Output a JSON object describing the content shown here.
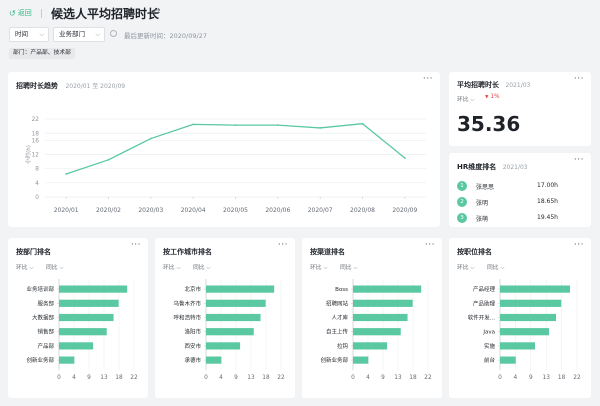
{
  "header": {
    "back_label": "返回",
    "title": "候选人平均招聘时长",
    "filters": {
      "time_label": "时间",
      "dept_label": "业务部门",
      "last_update": "最后更新时间：2020/09/27",
      "tag": "部门：产品部、技术部"
    }
  },
  "trend": {
    "title": "招聘时长趋势",
    "date_range": "2020/01 至 2020/09",
    "ylabel": "小时(h)"
  },
  "avg_card": {
    "title": "平均招聘时长",
    "date": "2021/03",
    "compare_label": "环比",
    "change": "1%",
    "value": "35.36"
  },
  "hr_card": {
    "title": "HR维度排名",
    "date": "2021/03",
    "items": [
      {
        "rank": "1",
        "name": "张思思",
        "value": "17.00h"
      },
      {
        "rank": "2",
        "name": "张明",
        "value": "18.65h"
      },
      {
        "rank": "3",
        "name": "张萌",
        "value": "19.45h"
      }
    ]
  },
  "rank_cards": [
    {
      "title": "按部门排名",
      "chip1": "环比",
      "chip2": "同比"
    },
    {
      "title": "按工作城市排名",
      "chip1": "环比",
      "chip2": "同比"
    },
    {
      "title": "按渠道排名",
      "chip1": "环比",
      "chip2": "同比"
    },
    {
      "title": "按职位排名",
      "chip1": "环比",
      "chip2": "同比"
    }
  ],
  "colors": {
    "accent": "#5ac8a0",
    "down": "#e5484d"
  },
  "chart_data": [
    {
      "type": "line",
      "title": "招聘时长趋势",
      "ylabel": "小时(h)",
      "x": [
        "2020/01",
        "2020/02",
        "2020/03",
        "2020/04",
        "2020/05",
        "2020/06",
        "2020/07",
        "2020/08",
        "2020/09"
      ],
      "values": [
        6.5,
        10.5,
        16.5,
        20.5,
        20.3,
        20.3,
        19.5,
        20.7,
        11
      ],
      "yticks": [
        0,
        4,
        8,
        12,
        16,
        18,
        22
      ],
      "ylim": [
        0,
        24
      ],
      "grid": true
    },
    {
      "type": "bar",
      "orientation": "horizontal",
      "title": "按部门排名",
      "categories": [
        "业务培训部",
        "服务部",
        "大数据部",
        "销售部",
        "产品部",
        "创新业务部"
      ],
      "values": [
        20,
        17.5,
        16,
        14,
        10,
        4.5
      ],
      "xticks": [
        "0",
        "4",
        "9",
        "13",
        "18",
        "22"
      ],
      "xlim": [
        0,
        22
      ]
    },
    {
      "type": "bar",
      "orientation": "horizontal",
      "title": "按工作城市排名",
      "categories": [
        "北京市",
        "乌鲁木齐市",
        "呼和浩特市",
        "洛阳市",
        "西安市",
        "承德市"
      ],
      "values": [
        20,
        17.5,
        16,
        14,
        10,
        4.5
      ],
      "xticks": [
        "0",
        "4",
        "9",
        "13",
        "18",
        "22"
      ],
      "xlim": [
        0,
        22
      ]
    },
    {
      "type": "bar",
      "orientation": "horizontal",
      "title": "按渠道排名",
      "categories": [
        "Boss",
        "招聘网站",
        "人才库",
        "自主上传",
        "拉钩",
        "创新业务部"
      ],
      "values": [
        20,
        17.5,
        16,
        14,
        10,
        4.5
      ],
      "xticks": [
        "0",
        "4",
        "9",
        "13",
        "18",
        "22"
      ],
      "xlim": [
        0,
        22
      ]
    },
    {
      "type": "bar",
      "orientation": "horizontal",
      "title": "按职位排名",
      "categories": [
        "产品经理",
        "产品助理",
        "软件开发...",
        "Java",
        "实施",
        "前台"
      ],
      "values": [
        20,
        17.5,
        16,
        14,
        10,
        4.5
      ],
      "xticks": [
        "0",
        "4",
        "9",
        "13",
        "18",
        "22"
      ],
      "xlim": [
        0,
        22
      ]
    }
  ]
}
